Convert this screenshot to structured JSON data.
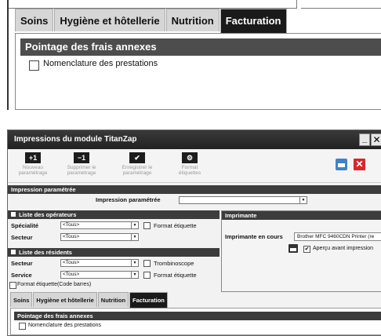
{
  "top_zoom": {
    "tabs": [
      "Soins",
      "Hygiène et hôtellerie",
      "Nutrition",
      "Facturation"
    ],
    "active_tab": 3,
    "section_title": "Pointage des frais annexes",
    "checkbox_label": "Nomenclature des prestations"
  },
  "window": {
    "title": "Impressions du module TitanZap",
    "minimize_glyph": "_",
    "close_glyph": "✕",
    "toolbar": [
      {
        "icon_text": "+1",
        "label_line1": "Nouveau",
        "label_line2": "paramétrage",
        "icon": "plus-one-icon"
      },
      {
        "icon_text": "−1",
        "label_line1": "Supprimer le",
        "label_line2": "paramétrage",
        "icon": "minus-one-icon"
      },
      {
        "icon_text": "✔",
        "label_line1": "Enregistrer le",
        "label_line2": "paramétrage",
        "icon": "checkmark-icon"
      },
      {
        "icon_text": "⚙",
        "label_line1": "Format",
        "label_line2": "étiquettes",
        "icon": "gears-icon"
      }
    ],
    "print_icon": "printer-icon",
    "cancel_glyph": "✕",
    "impression_parametree_header": "Impression paramétrée",
    "impression_parametree_label": "Impression paramétrée",
    "impression_parametree_value": "",
    "operateurs": {
      "header": "Liste des opérateurs",
      "specialite_label": "Spécialité",
      "specialite_value": "<Tous>",
      "secteur_label": "Secteur",
      "secteur_value": "<Tous>",
      "format_etiquette": "Format étiquette"
    },
    "residents": {
      "header": "Liste des résidents",
      "secteur_label": "Secteur",
      "secteur_value": "<Tous>",
      "service_label": "Service",
      "service_value": "<Tous>",
      "trombinoscope": "Trombinoscope",
      "format_etiquette": "Format étiquette",
      "format_code_barres": "Format étiquette(Code barres)"
    },
    "imprimante": {
      "header": "Imprimante",
      "en_cours_label": "Imprimante en cours",
      "en_cours_value": "Brother MFC 9460CDN Printer (re",
      "apercu_label": "Aperçu avant impression",
      "apercu_checked": true
    },
    "tabs": [
      "Soins",
      "Hygiène et hôtellerie",
      "Nutrition",
      "Facturation"
    ],
    "active_tab": 3,
    "section_title": "Pointage des frais annexes",
    "checkbox_label": "Nomenclature des prestations"
  }
}
